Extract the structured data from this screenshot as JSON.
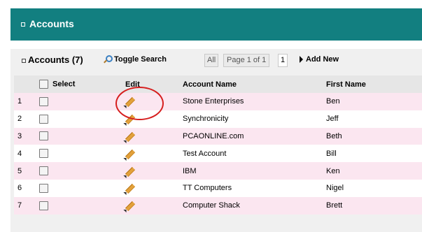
{
  "header": {
    "title": "Accounts"
  },
  "toolbar": {
    "title": "Accounts (7)",
    "toggle_search": "Toggle Search",
    "pager_all": "All",
    "pager_page": "Page 1 of 1",
    "pager_num": "1",
    "add_new": "Add New"
  },
  "table": {
    "headers": {
      "select": "Select",
      "edit": "Edit",
      "account": "Account Name",
      "first": "First Name"
    },
    "rows": [
      {
        "num": "1",
        "account": "Stone Enterprises",
        "first": "Ben"
      },
      {
        "num": "2",
        "account": "Synchronicity",
        "first": "Jeff"
      },
      {
        "num": "3",
        "account": "PCAONLINE.com",
        "first": "Beth"
      },
      {
        "num": "4",
        "account": "Test Account",
        "first": "Bill"
      },
      {
        "num": "5",
        "account": "IBM",
        "first": "Ken"
      },
      {
        "num": "6",
        "account": "TT Computers",
        "first": "Nigel"
      },
      {
        "num": "7",
        "account": "Computer Shack",
        "first": "Brett"
      }
    ]
  },
  "colors": {
    "header_teal": "#127f80",
    "row_pink": "#fbe6f0",
    "highlight_red": "#d61e1e"
  },
  "icons": {
    "edit": "pencil-icon",
    "search": "magnifier-icon",
    "add": "triangle-right-icon"
  }
}
